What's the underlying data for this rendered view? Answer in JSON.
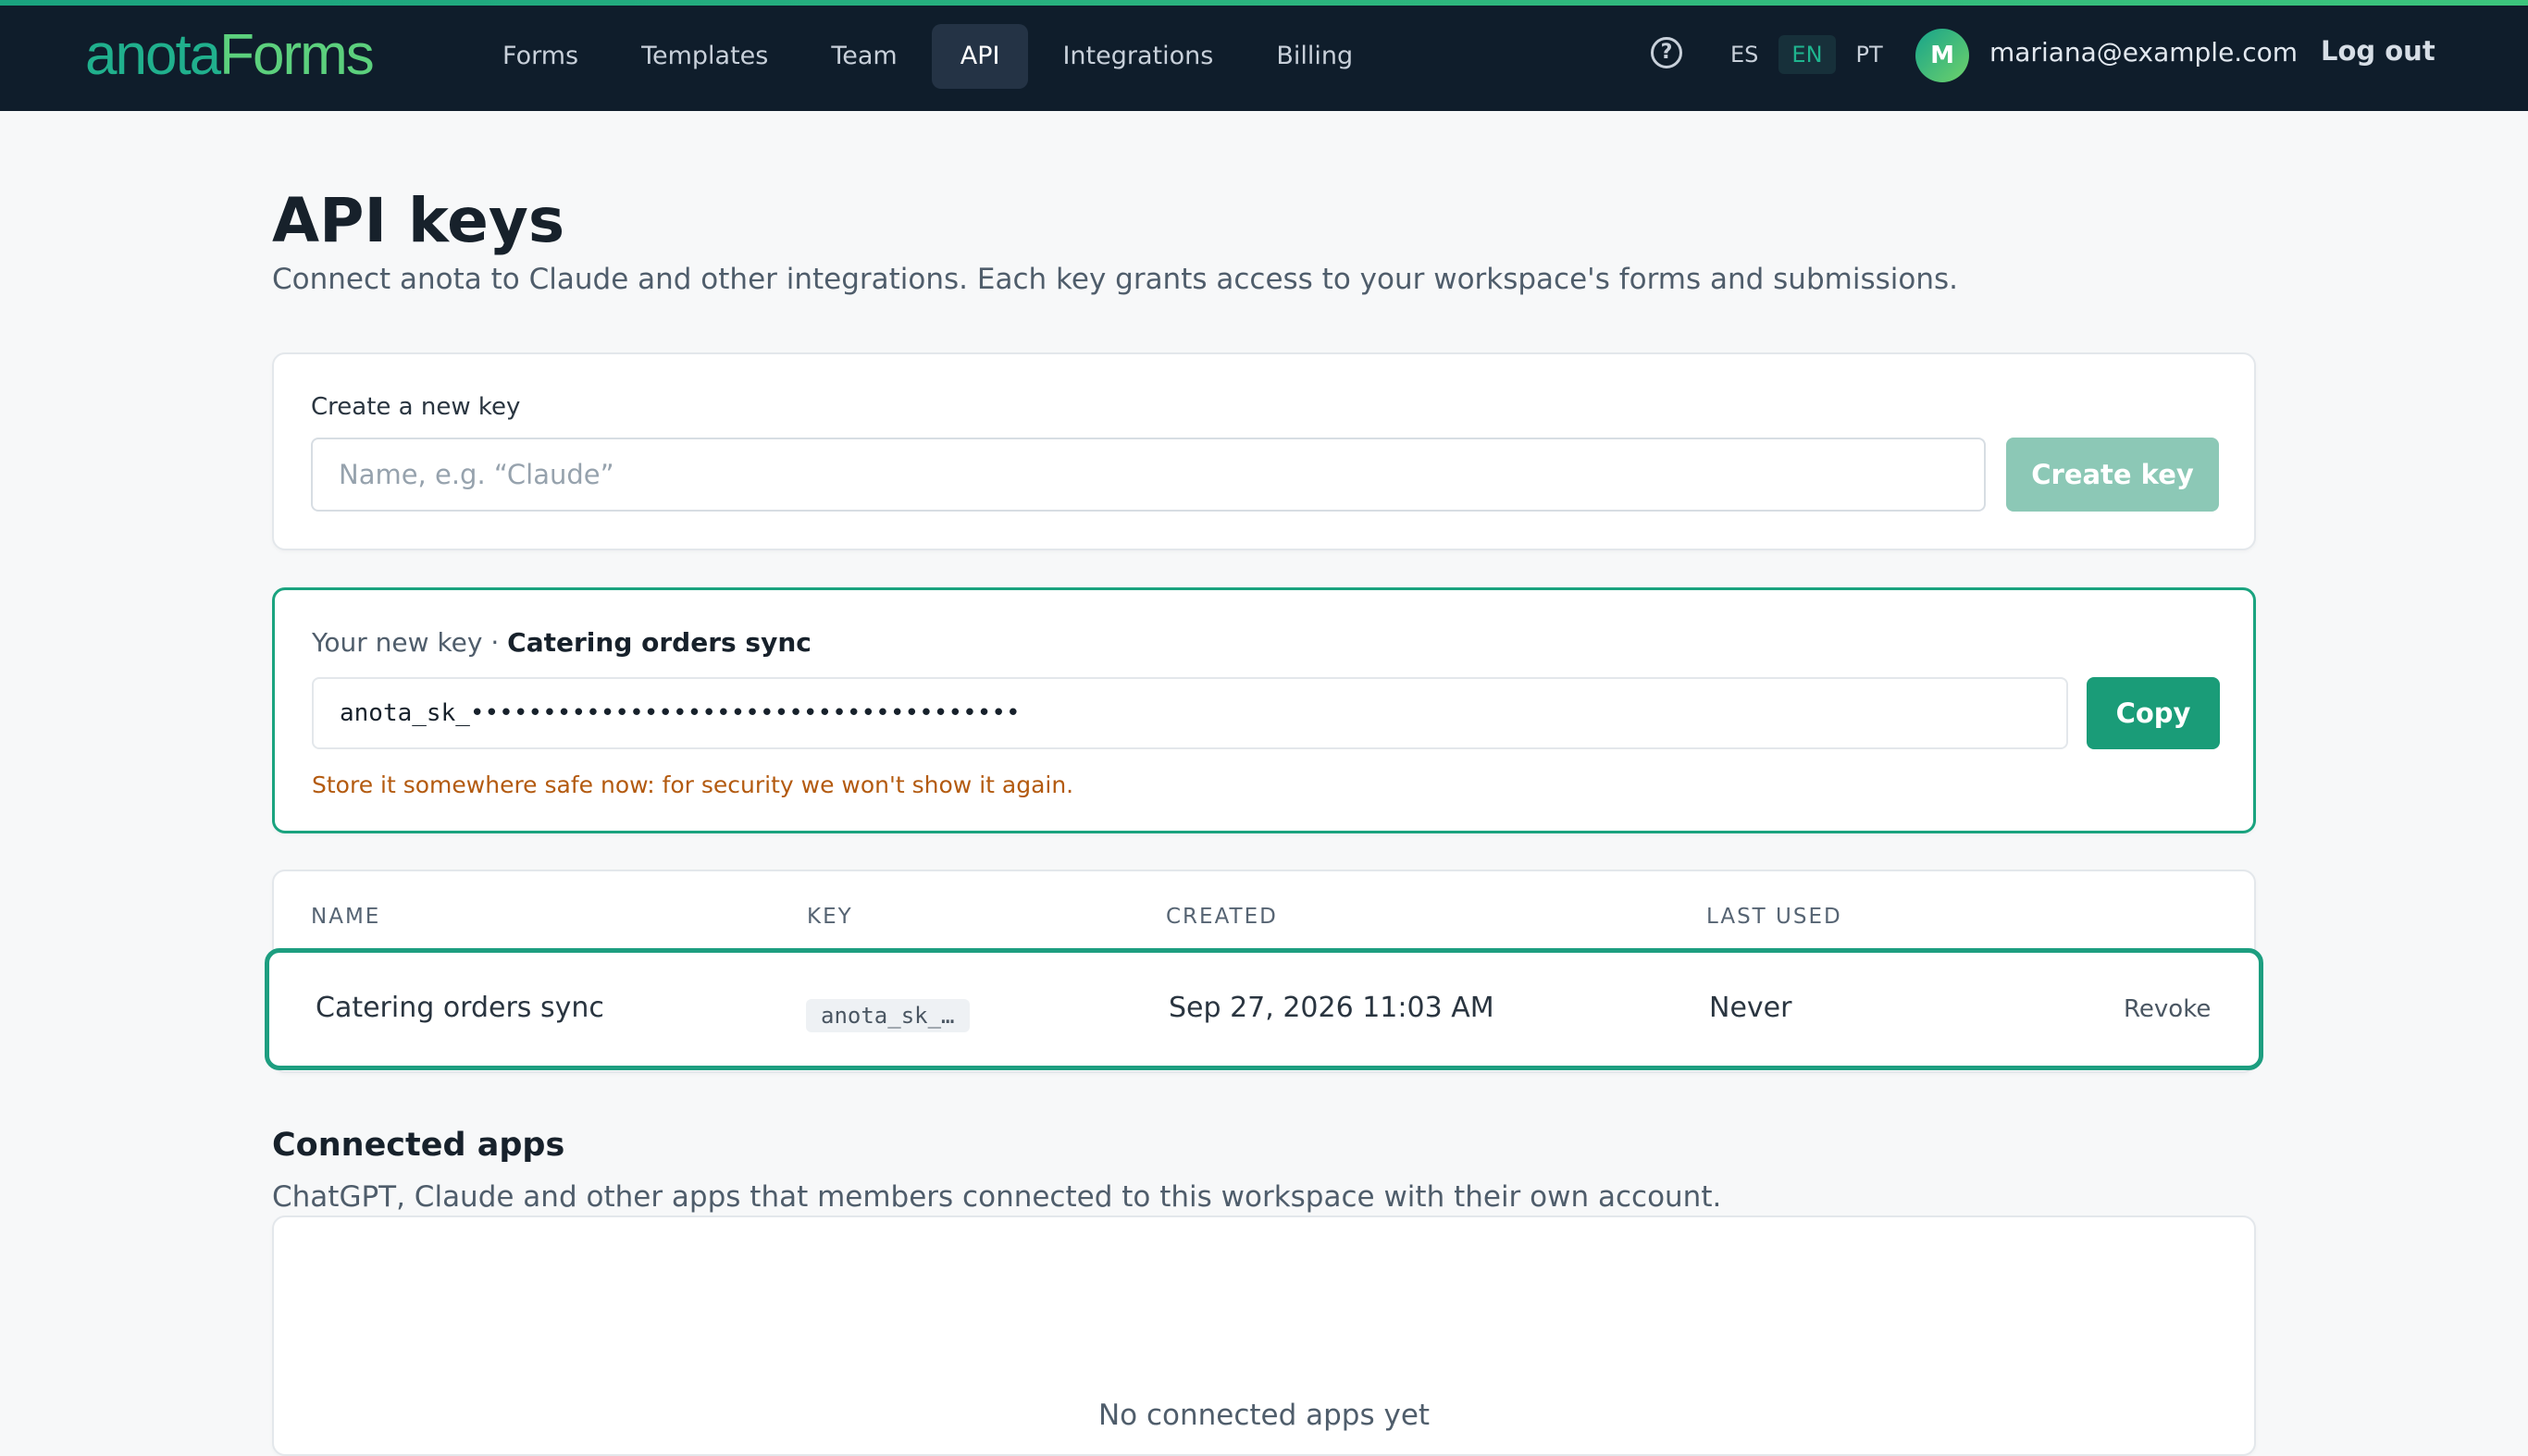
{
  "brand": {
    "part1": "anota",
    "part2": "Forms"
  },
  "nav": {
    "items": [
      {
        "label": "Forms"
      },
      {
        "label": "Templates"
      },
      {
        "label": "Team"
      },
      {
        "label": "API",
        "active": true
      },
      {
        "label": "Integrations"
      },
      {
        "label": "Billing"
      }
    ]
  },
  "header": {
    "help_icon": "question-circle-icon",
    "languages": [
      "ES",
      "EN",
      "PT"
    ],
    "active_language": "EN",
    "avatar_initial": "M",
    "user_email": "mariana@example.com",
    "logout_label": "Log out"
  },
  "page": {
    "title": "API keys",
    "subtitle": "Connect anota to Claude and other integrations. Each key grants access to your workspace's forms and submissions."
  },
  "create": {
    "label": "Create a new key",
    "placeholder": "Name, e.g. “Claude”",
    "value": "",
    "button": "Create key"
  },
  "new_key": {
    "prefix": "Your new key · ",
    "name": "Catering orders sync",
    "masked_value": "anota_sk_••••••••••••••••••••••••••••••••••••••",
    "copy_label": "Copy",
    "warning": "Store it somewhere safe now: for security we won't show it again."
  },
  "keys_table": {
    "headers": {
      "name": "NAME",
      "key": "KEY",
      "created": "CREATED",
      "last_used": "LAST USED"
    },
    "rows": [
      {
        "name": "Catering orders sync",
        "key": "anota_sk_…",
        "created": "Sep 27, 2026 11:03 AM",
        "last_used": "Never",
        "action": "Revoke"
      }
    ]
  },
  "connected_apps": {
    "title": "Connected apps",
    "subtitle": "ChatGPT, Claude and other apps that members connected to this workspace with their own account.",
    "empty": "No connected apps yet"
  },
  "colors": {
    "brand": "#1aa37f",
    "topbar": "#0f1d2b",
    "warning": "#b35a0f"
  }
}
